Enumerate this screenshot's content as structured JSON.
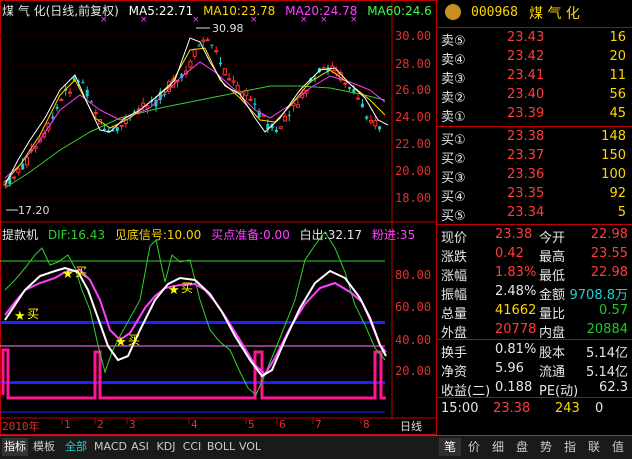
{
  "chart": {
    "title_name": "煤 气 化(日线,前复权)",
    "ma": [
      {
        "label": "MA5:22.71",
        "color": "#ffffff"
      },
      {
        "label": "MA10:23.78",
        "color": "#ffd700"
      },
      {
        "label": "MA20:24.78",
        "color": "#ff40ff"
      },
      {
        "label": "MA60:24.6",
        "color": "#40ff40"
      }
    ],
    "y_ticks": [
      "30.00",
      "28.00",
      "26.00",
      "24.00",
      "22.00",
      "20.00",
      "18.00"
    ],
    "high_marker": "30.98",
    "low_marker": "17.20"
  },
  "indicator": {
    "name": "提款机",
    "dif": "DIF:16.43",
    "jiandi": "见底信号:10.00",
    "maidian": "买点准备:0.00",
    "baichu": "白出:32.17",
    "fenjin": "粉进:35",
    "y_ticks": [
      "80.00",
      "60.00",
      "40.00",
      "20.00"
    ],
    "buy_label": "买"
  },
  "x_axis": {
    "months": [
      "2010年",
      "1",
      "2",
      "3",
      "4",
      "5",
      "6",
      "7",
      "8"
    ],
    "period": "日线"
  },
  "bottom_tabs": [
    "指标",
    "模板",
    "全部",
    "MACD",
    "ASI",
    "KDJ",
    "CCI",
    "BOLL",
    "VOL"
  ],
  "quote": {
    "code": "000968",
    "name": "煤 气 化",
    "asks": [
      {
        "label": "卖⑤",
        "price": "23.43",
        "vol": "16"
      },
      {
        "label": "卖④",
        "price": "23.42",
        "vol": "20"
      },
      {
        "label": "卖③",
        "price": "23.41",
        "vol": "11"
      },
      {
        "label": "卖②",
        "price": "23.40",
        "vol": "56"
      },
      {
        "label": "卖①",
        "price": "23.39",
        "vol": "45"
      }
    ],
    "bids": [
      {
        "label": "买①",
        "price": "23.38",
        "vol": "148"
      },
      {
        "label": "买②",
        "price": "23.37",
        "vol": "150"
      },
      {
        "label": "买③",
        "price": "23.36",
        "vol": "100"
      },
      {
        "label": "买④",
        "price": "23.35",
        "vol": "92"
      },
      {
        "label": "买⑤",
        "price": "23.34",
        "vol": "5"
      }
    ],
    "stats1": [
      {
        "l1": "现价",
        "v1": "23.38",
        "c1": "red",
        "l2": "今开",
        "v2": "22.98",
        "c2": "red"
      },
      {
        "l1": "涨跌",
        "v1": "0.42",
        "c1": "red",
        "l2": "最高",
        "v2": "23.55",
        "c2": "red"
      },
      {
        "l1": "涨幅",
        "v1": "1.83%",
        "c1": "red",
        "l2": "最低",
        "v2": "22.98",
        "c2": "red"
      },
      {
        "l1": "振幅",
        "v1": "2.48%",
        "c1": "white",
        "l2": "金额",
        "v2": "9708.8万",
        "c2": "cyan"
      },
      {
        "l1": "总量",
        "v1": "41662",
        "c1": "yellow",
        "l2": "量比",
        "v2": "0.57",
        "c2": "green"
      },
      {
        "l1": "外盘",
        "v1": "20778",
        "c1": "red",
        "l2": "内盘",
        "v2": "20884",
        "c2": "green"
      }
    ],
    "stats2": [
      {
        "l1": "换手",
        "v1": "0.81%",
        "c1": "white",
        "l2": "股本",
        "v2": "5.14亿",
        "c2": "white"
      },
      {
        "l1": "净资",
        "v1": "5.96",
        "c1": "white",
        "l2": "流通",
        "v2": "5.14亿",
        "c2": "white"
      },
      {
        "l1": "收益(二)",
        "v1": "0.188",
        "c1": "white",
        "l2": "PE(动)",
        "v2": "62.3",
        "c2": "white"
      }
    ],
    "trade": {
      "time": "15:00",
      "price": "23.38",
      "vol": "243",
      "flag": "0"
    }
  },
  "right_tabs": [
    "笔",
    "价",
    "细",
    "盘",
    "势",
    "指",
    "联",
    "值"
  ]
}
